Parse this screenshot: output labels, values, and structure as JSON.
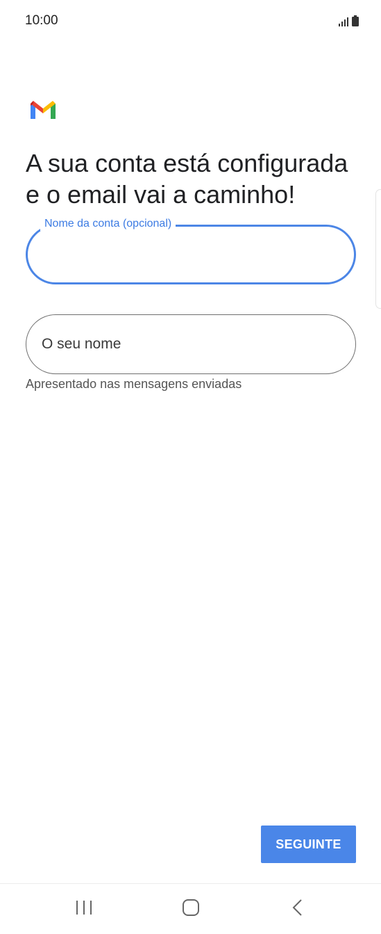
{
  "status_bar": {
    "time": "10:00",
    "icons": [
      "signal-icon",
      "battery-icon"
    ]
  },
  "logo": {
    "icon": "gmail-logo",
    "colors": {
      "blue": "#4285F4",
      "red": "#EA4335",
      "yellow": "#FBBC04",
      "green": "#34A853"
    }
  },
  "heading": {
    "line1": "A sua conta está configurada",
    "line2": "e o email vai a caminho!"
  },
  "account_name_field": {
    "label": "Nome da conta (opcional)",
    "value": "",
    "state": "focused"
  },
  "your_name_field": {
    "placeholder": "O seu nome",
    "value": ""
  },
  "helper_text": "Apresentado nas mensagens enviadas",
  "next_button": {
    "label": "SEGUINTE"
  },
  "nav_bar": {
    "icons": [
      "recents-icon",
      "home-icon",
      "back-icon"
    ]
  },
  "colors": {
    "accent": "#4A86E8",
    "focus_border": "#4C86E6",
    "label": "#3C7BE3"
  }
}
